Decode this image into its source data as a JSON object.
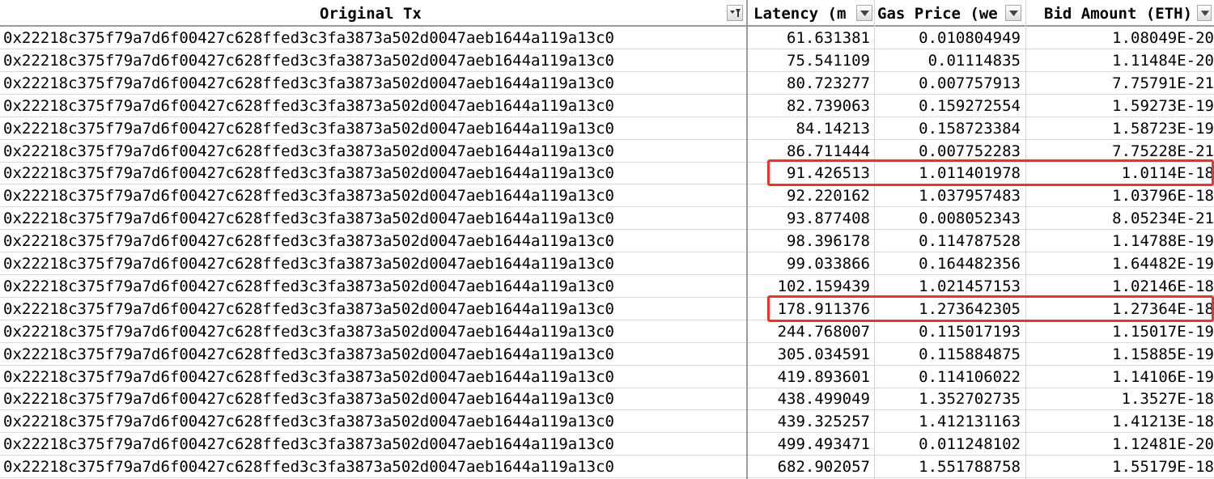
{
  "headers": {
    "original_tx": "Original Tx",
    "latency": "Latency (m",
    "gas_price": "Gas Price (we",
    "bid_amount": "Bid Amount (ETH)"
  },
  "colors": {
    "highlight": "#e8352b",
    "header_border": "#9a9a9a",
    "grid": "#d9d9d9"
  },
  "icons": {
    "filter_active": "filter-active-icon",
    "dropdown": "dropdown-arrow-icon"
  },
  "rows": [
    {
      "tx": "0x22218c375f79a7d6f00427c628ffed3c3fa3873a502d0047aeb1644a119a13c0",
      "latency": "61.631381",
      "gas": "0.010804949",
      "bid": "1.08049E-20"
    },
    {
      "tx": "0x22218c375f79a7d6f00427c628ffed3c3fa3873a502d0047aeb1644a119a13c0",
      "latency": "75.541109",
      "gas": "0.01114835",
      "bid": "1.11484E-20"
    },
    {
      "tx": "0x22218c375f79a7d6f00427c628ffed3c3fa3873a502d0047aeb1644a119a13c0",
      "latency": "80.723277",
      "gas": "0.007757913",
      "bid": "7.75791E-21"
    },
    {
      "tx": "0x22218c375f79a7d6f00427c628ffed3c3fa3873a502d0047aeb1644a119a13c0",
      "latency": "82.739063",
      "gas": "0.159272554",
      "bid": "1.59273E-19"
    },
    {
      "tx": "0x22218c375f79a7d6f00427c628ffed3c3fa3873a502d0047aeb1644a119a13c0",
      "latency": "84.14213",
      "gas": "0.158723384",
      "bid": "1.58723E-19"
    },
    {
      "tx": "0x22218c375f79a7d6f00427c628ffed3c3fa3873a502d0047aeb1644a119a13c0",
      "latency": "86.711444",
      "gas": "0.007752283",
      "bid": "7.75228E-21"
    },
    {
      "tx": "0x22218c375f79a7d6f00427c628ffed3c3fa3873a502d0047aeb1644a119a13c0",
      "latency": "91.426513",
      "gas": "1.011401978",
      "bid": "1.0114E-18",
      "highlighted": true
    },
    {
      "tx": "0x22218c375f79a7d6f00427c628ffed3c3fa3873a502d0047aeb1644a119a13c0",
      "latency": "92.220162",
      "gas": "1.037957483",
      "bid": "1.03796E-18"
    },
    {
      "tx": "0x22218c375f79a7d6f00427c628ffed3c3fa3873a502d0047aeb1644a119a13c0",
      "latency": "93.877408",
      "gas": "0.008052343",
      "bid": "8.05234E-21"
    },
    {
      "tx": "0x22218c375f79a7d6f00427c628ffed3c3fa3873a502d0047aeb1644a119a13c0",
      "latency": "98.396178",
      "gas": "0.114787528",
      "bid": "1.14788E-19"
    },
    {
      "tx": "0x22218c375f79a7d6f00427c628ffed3c3fa3873a502d0047aeb1644a119a13c0",
      "latency": "99.033866",
      "gas": "0.164482356",
      "bid": "1.64482E-19"
    },
    {
      "tx": "0x22218c375f79a7d6f00427c628ffed3c3fa3873a502d0047aeb1644a119a13c0",
      "latency": "102.159439",
      "gas": "1.021457153",
      "bid": "1.02146E-18"
    },
    {
      "tx": "0x22218c375f79a7d6f00427c628ffed3c3fa3873a502d0047aeb1644a119a13c0",
      "latency": "178.911376",
      "gas": "1.273642305",
      "bid": "1.27364E-18",
      "highlighted": true
    },
    {
      "tx": "0x22218c375f79a7d6f00427c628ffed3c3fa3873a502d0047aeb1644a119a13c0",
      "latency": "244.768007",
      "gas": "0.115017193",
      "bid": "1.15017E-19"
    },
    {
      "tx": "0x22218c375f79a7d6f00427c628ffed3c3fa3873a502d0047aeb1644a119a13c0",
      "latency": "305.034591",
      "gas": "0.115884875",
      "bid": "1.15885E-19"
    },
    {
      "tx": "0x22218c375f79a7d6f00427c628ffed3c3fa3873a502d0047aeb1644a119a13c0",
      "latency": "419.893601",
      "gas": "0.114106022",
      "bid": "1.14106E-19"
    },
    {
      "tx": "0x22218c375f79a7d6f00427c628ffed3c3fa3873a502d0047aeb1644a119a13c0",
      "latency": "438.499049",
      "gas": "1.352702735",
      "bid": "1.3527E-18"
    },
    {
      "tx": "0x22218c375f79a7d6f00427c628ffed3c3fa3873a502d0047aeb1644a119a13c0",
      "latency": "439.325257",
      "gas": "1.412131163",
      "bid": "1.41213E-18"
    },
    {
      "tx": "0x22218c375f79a7d6f00427c628ffed3c3fa3873a502d0047aeb1644a119a13c0",
      "latency": "499.493471",
      "gas": "0.011248102",
      "bid": "1.12481E-20"
    },
    {
      "tx": "0x22218c375f79a7d6f00427c628ffed3c3fa3873a502d0047aeb1644a119a13c0",
      "latency": "682.902057",
      "gas": "1.551788758",
      "bid": "1.55179E-18"
    }
  ]
}
